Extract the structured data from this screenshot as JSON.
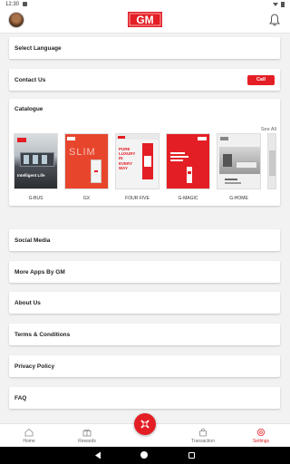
{
  "status_bar": {
    "time": "12:30"
  },
  "header": {
    "logo_text": "GM"
  },
  "menu": {
    "select_language": "Select Language",
    "contact_us": "Contact Us",
    "call_label": "Call",
    "social_media": "Social Media",
    "more_apps": "More Apps By GM",
    "about_us": "About Us",
    "terms": "Terms & Conditions",
    "privacy": "Privacy Policy",
    "faq": "FAQ"
  },
  "catalogue": {
    "title": "Catalogue",
    "see_all": "See All",
    "items": [
      {
        "label": "G-BUS",
        "cover_text": "Intelligent Life"
      },
      {
        "label": "GX",
        "cover_text": "SLIM"
      },
      {
        "label": "FOUR FIVE",
        "cover_text": "PURE LUXURY IN EVERY WAY"
      },
      {
        "label": "G-MAGIC",
        "cover_text": ""
      },
      {
        "label": "G-HOME",
        "cover_text": ""
      }
    ]
  },
  "bottom_nav": {
    "home": "Home",
    "rewards": "Rewards",
    "transaction": "Transaction",
    "settings": "Settings"
  },
  "colors": {
    "brand_red": "#e31e24"
  }
}
